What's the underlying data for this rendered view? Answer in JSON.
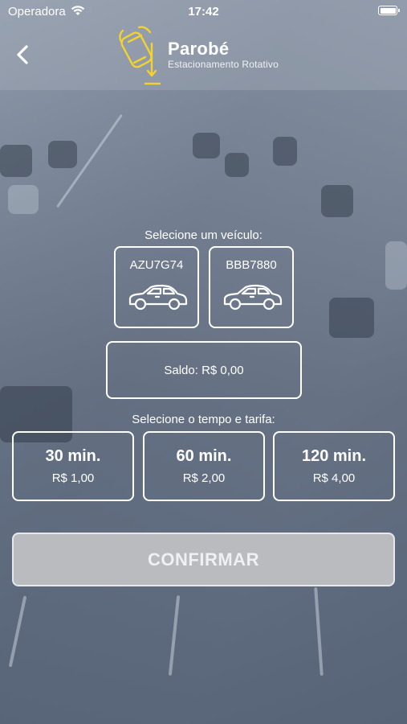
{
  "status_bar": {
    "carrier": "Operadora",
    "time": "17:42"
  },
  "header": {
    "title": "Parobé",
    "subtitle": "Estacionamento Rotativo"
  },
  "vehicles": {
    "label": "Selecione um veículo:",
    "items": [
      {
        "plate": "AZU7G74"
      },
      {
        "plate": "BBB7880"
      }
    ]
  },
  "balance": {
    "text": "Saldo: R$ 0,00"
  },
  "tariffs": {
    "label": "Selecione o tempo e tarifa:",
    "items": [
      {
        "time": "30 min.",
        "price": "R$ 1,00"
      },
      {
        "time": "60 min.",
        "price": "R$ 2,00"
      },
      {
        "time": "120 min.",
        "price": "R$ 4,00"
      }
    ]
  },
  "confirm_label": "CONFIRMAR",
  "colors": {
    "accent_yellow": "#f2d22e",
    "button_disabled": "#b9bbbf",
    "foreground": "#ffffff"
  }
}
